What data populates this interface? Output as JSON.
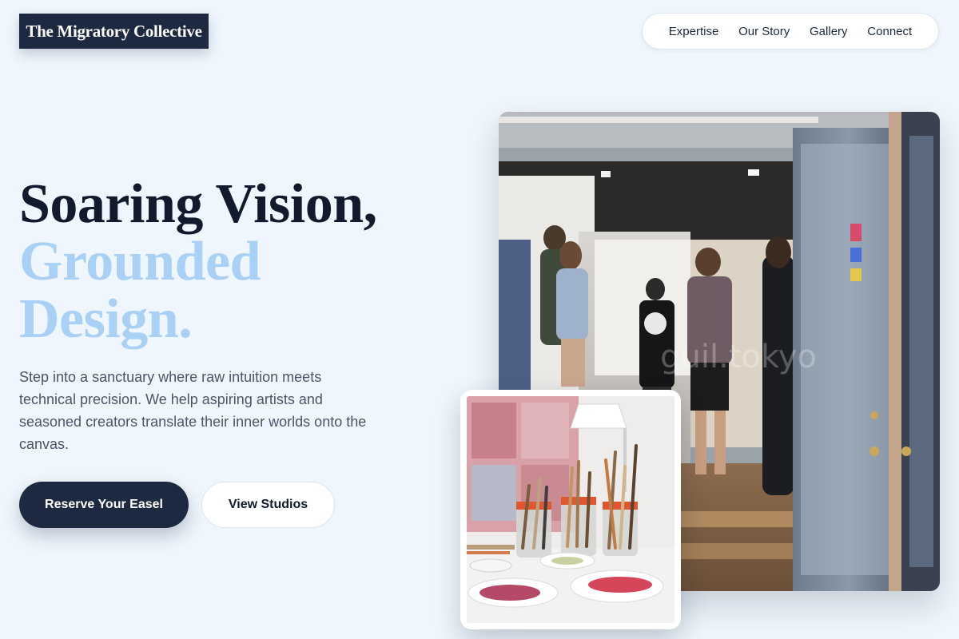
{
  "brand": {
    "name": "The Migratory Collective"
  },
  "nav": {
    "items": [
      {
        "label": "Expertise"
      },
      {
        "label": "Our Story"
      },
      {
        "label": "Gallery"
      },
      {
        "label": "Connect"
      }
    ]
  },
  "hero": {
    "headline_line1": "Soaring Vision,",
    "headline_line2": "Grounded",
    "headline_line3": "Design.",
    "description": "Step into a sanctuary where raw intuition meets technical precision. We help aspiring artists and seasoned creators translate their inner worlds onto the canvas.",
    "primary_button": "Reserve Your Easel",
    "secondary_button": "View Studios"
  },
  "media": {
    "main_photo_watermark": "guil.tokyo"
  },
  "colors": {
    "background": "#eff6fd",
    "navy": "#1d2940",
    "headline_dark": "#111b2d",
    "headline_light": "#a9d1f6",
    "body_text": "#4a5568"
  }
}
